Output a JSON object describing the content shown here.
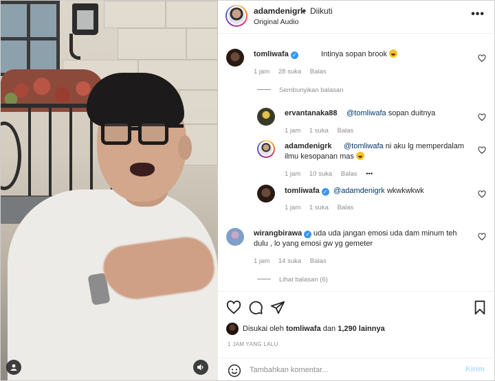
{
  "header": {
    "username": "adamdenigrk",
    "separator": "•",
    "follow_status": "Diikuti",
    "audio": "Original Audio",
    "more_icon": "more-horizontal-icon"
  },
  "comments": [
    {
      "username": "tomliwafa",
      "verified": true,
      "text": "Intinya sopan brook",
      "time": "1 jam",
      "likes": "28 suka",
      "reply": "Balas"
    }
  ],
  "hide_replies": "Sembunyikan balasan",
  "replies": [
    {
      "username": "ervantanaka88",
      "mention": "@tomliwafa",
      "text": " sopan duitnya",
      "time": "1 jam",
      "likes": "1 suka",
      "reply": "Balas"
    },
    {
      "username": "adamdenigrk",
      "mention": "@tomliwafa",
      "text": " ni aku lg memperdalam",
      "text2": "ilmu kesopanan mas",
      "time": "1 jam",
      "likes": "10 suka",
      "reply": "Balas",
      "more": "•••"
    },
    {
      "username": "tomliwafa",
      "verified": true,
      "mention": "@adamdenigrk",
      "text": " wkwkwkwk",
      "time": "1 jam",
      "likes": "1 suka",
      "reply": "Balas"
    }
  ],
  "comment2": {
    "username": "wirangbirawa",
    "verified": true,
    "text": "uda uda jangan emosi uda dam minum teh",
    "text2": "dulu , lo yang emosi gw yg gemeter",
    "time": "1 jam",
    "likes": "14 suka",
    "reply": "Balas"
  },
  "view_replies": "Lihat balasan (6)",
  "actions": {
    "like_icon": "heart-icon",
    "comment_icon": "comment-icon",
    "share_icon": "send-icon",
    "save_icon": "bookmark-icon"
  },
  "likes": {
    "prefix": "Disukai oleh",
    "user": "tomliwafa",
    "middle": "dan",
    "count": "1,290 lainnya"
  },
  "time_ago": "1 JAM YANG LALU",
  "composer": {
    "placeholder": "Tambahkan komentar...",
    "post": "Kirim"
  },
  "colors": {
    "verified": "#3897f0",
    "muted": "#8e8e8e",
    "mention": "#00376b",
    "post_disabled": "#b2dffc"
  }
}
